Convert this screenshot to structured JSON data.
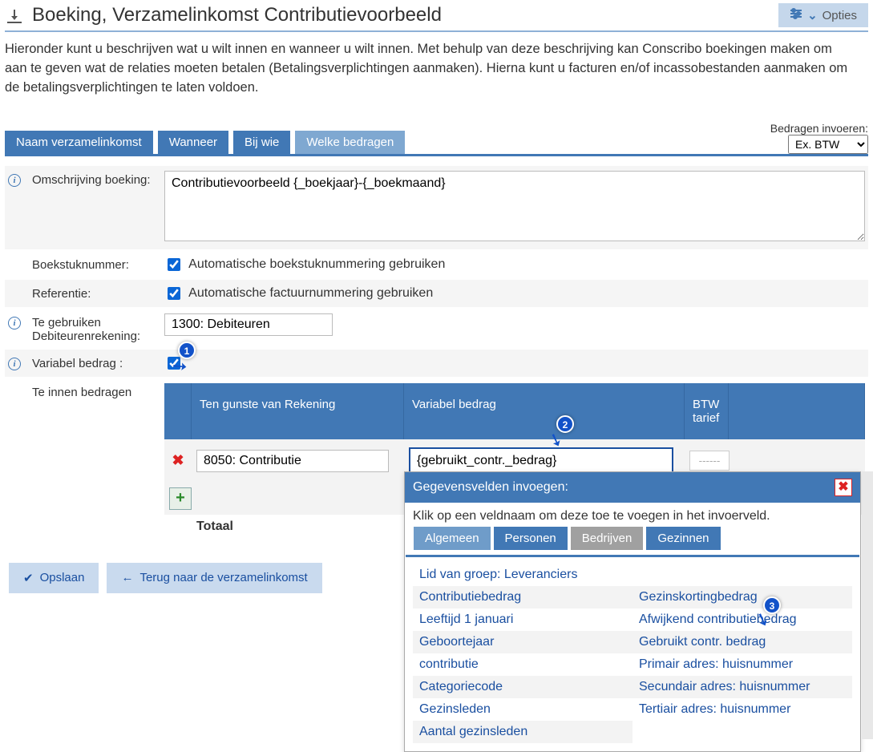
{
  "header": {
    "title": "Boeking, Verzamelinkomst Contributievoorbeeld",
    "options_label": "Opties"
  },
  "intro": "Hieronder kunt u beschrijven wat u wilt innen en wanneer u wilt innen. Met behulp van deze beschrijving kan Conscribo boekingen maken om aan te geven wat de relaties moeten betalen (Betalingsverplichtingen aanmaken). Hierna kunt u facturen en/of incassobestanden aanmaken om de betalingsverplichtingen te laten voldoen.",
  "tabs": {
    "items": [
      "Naam verzamelinkomst",
      "Wanneer",
      "Bij wie",
      "Welke bedragen"
    ],
    "active_index": 3,
    "amounts_label": "Bedragen invoeren:",
    "amounts_select": "Ex. BTW"
  },
  "form": {
    "desc_label": "Omschrijving boeking:",
    "desc_value": "Contributievoorbeeld {_boekjaar}-{_boekmaand}",
    "boekstuk_label": "Boekstuknummer:",
    "boekstuk_checkbox": "Automatische boekstuknummering gebruiken",
    "referentie_label": "Referentie:",
    "referentie_checkbox": "Automatische factuurnummering gebruiken",
    "debit_label": "Te gebruiken Debiteurenrekening:",
    "debit_value": "1300: Debiteuren",
    "variabel_label": "Variabel bedrag :",
    "te_innen_label": "Te innen bedragen"
  },
  "amounts_table": {
    "headers": {
      "account": "Ten gunste van Rekening",
      "variable": "Variabel bedrag",
      "btw": "BTW tarief"
    },
    "rows": [
      {
        "account": "8050: Contributie",
        "variable": "{gebruikt_contr._bedrag}",
        "btw": "------"
      }
    ],
    "total_label": "Totaal"
  },
  "actions": {
    "save": "Opslaan",
    "back": "Terug naar de verzamelinkomst"
  },
  "popup": {
    "title": "Gegevensvelden invoegen:",
    "hint": "Klik op een veldnaam om deze toe te voegen in het invoerveld.",
    "tabs": [
      "Algemeen",
      "Personen",
      "Bedrijven",
      "Gezinnen"
    ],
    "fields_left": [
      "Lid van groep: Leveranciers",
      "Contributiebedrag",
      "Leeftijd 1 januari",
      "Geboortejaar",
      "contributie",
      "Categoriecode",
      "Gezinsleden",
      "Aantal gezinsleden"
    ],
    "fields_right": [
      "",
      "Gezinskortingbedrag",
      "Afwijkend contributiebedrag",
      "Gebruikt contr. bedrag",
      "Primair adres: huisnummer",
      "Secundair adres: huisnummer",
      "Tertiair adres: huisnummer"
    ]
  },
  "badges": {
    "b1": "1",
    "b2": "2",
    "b3": "3"
  }
}
